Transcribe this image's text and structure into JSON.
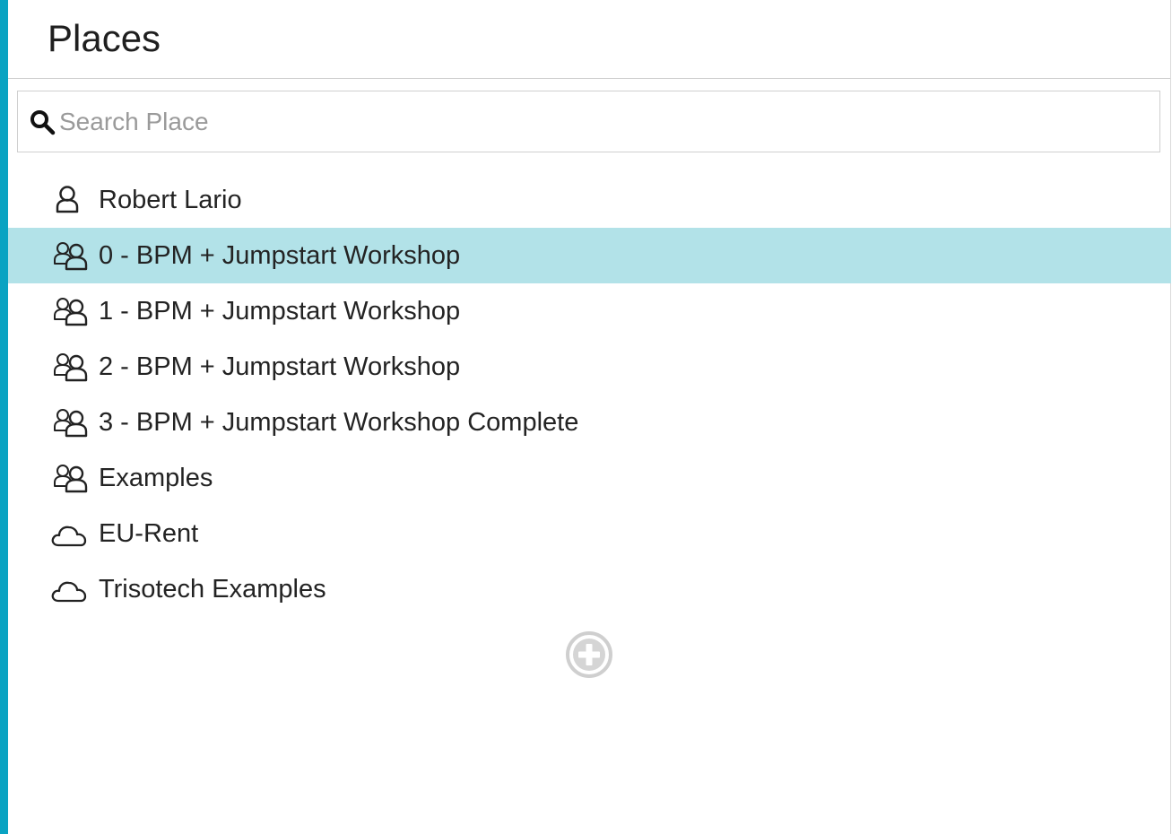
{
  "header": {
    "title": "Places"
  },
  "search": {
    "placeholder": "Search Place",
    "value": "",
    "icon": "search-icon"
  },
  "places": [
    {
      "label": "Robert Lario",
      "icon": "user-icon",
      "selected": false
    },
    {
      "label": "0 - BPM + Jumpstart Workshop",
      "icon": "group-icon",
      "selected": true
    },
    {
      "label": "1 - BPM + Jumpstart Workshop",
      "icon": "group-icon",
      "selected": false
    },
    {
      "label": "2 - BPM + Jumpstart Workshop",
      "icon": "group-icon",
      "selected": false
    },
    {
      "label": "3 - BPM + Jumpstart Workshop Complete",
      "icon": "group-icon",
      "selected": false
    },
    {
      "label": "Examples",
      "icon": "group-icon",
      "selected": false
    },
    {
      "label": "EU-Rent",
      "icon": "cloud-icon",
      "selected": false
    },
    {
      "label": "Trisotech Examples",
      "icon": "cloud-icon",
      "selected": false
    }
  ],
  "actions": {
    "add_icon": "plus-circle-icon"
  },
  "colors": {
    "accent": "#0aa3c2",
    "selected_row": "#b2e2e8",
    "icon_gray": "#d0d0d0"
  }
}
